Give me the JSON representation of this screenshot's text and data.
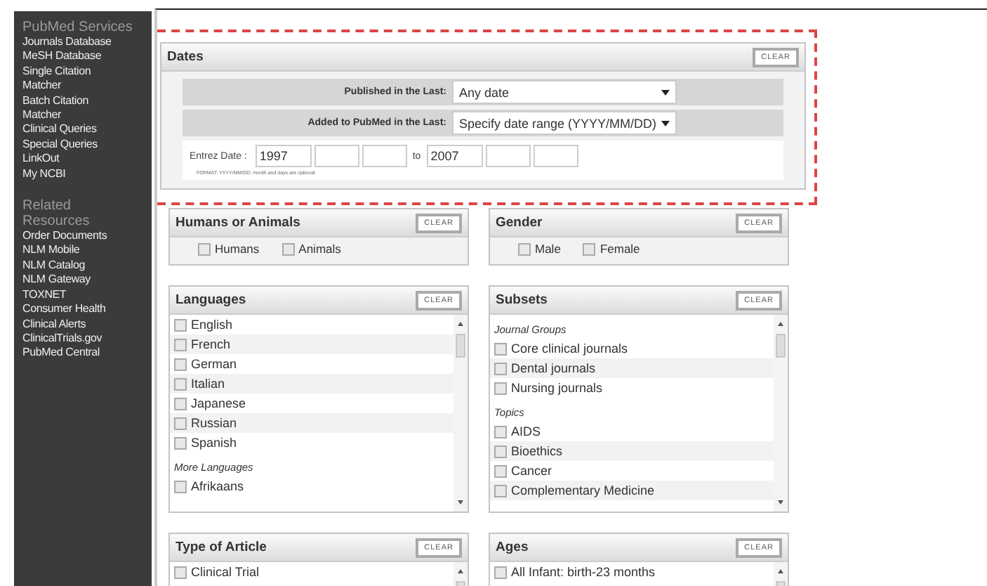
{
  "sidebar": {
    "sections": [
      {
        "heading": "PubMed Services",
        "items": [
          "Journals Database",
          "MeSH Database",
          "Single Citation Matcher",
          "Batch Citation Matcher",
          "Clinical Queries",
          "Special Queries",
          "LinkOut",
          "My NCBI"
        ]
      },
      {
        "heading": "Related Resources",
        "items": [
          "Order Documents",
          "NLM Mobile",
          "NLM Catalog",
          "NLM Gateway",
          "TOXNET",
          "Consumer Health",
          "Clinical Alerts",
          "ClinicalTrials.gov",
          "PubMed Central"
        ]
      }
    ]
  },
  "dates": {
    "title": "Dates",
    "clear": "CLEAR",
    "selects": [
      {
        "label": "Published in the Last:",
        "value": "Any date"
      },
      {
        "label": "Added to PubMed in the Last:",
        "value": "Specify date range (YYYY/MM/DD)"
      }
    ],
    "entrez": {
      "label": "Entrez Date :",
      "from_year": "1997",
      "to": "to",
      "to_year": "2007",
      "format": "FORMAT: YYYY/MM/DD; month and days are optional"
    }
  },
  "panel_rows": [
    [
      {
        "title": "Humans or Animals",
        "clear": "CLEAR",
        "kind": "inline",
        "items": [
          {
            "kind": "option",
            "label": "Humans",
            "checked": false
          },
          {
            "kind": "option",
            "label": "Animals",
            "checked": false
          }
        ]
      },
      {
        "title": "Gender",
        "clear": "CLEAR",
        "kind": "inline",
        "items": [
          {
            "kind": "option",
            "label": "Male",
            "checked": false
          },
          {
            "kind": "option",
            "label": "Female",
            "checked": false
          }
        ]
      }
    ],
    [
      {
        "title": "Languages",
        "clear": "CLEAR",
        "kind": "list",
        "items": [
          {
            "kind": "option",
            "label": "English",
            "checked": false
          },
          {
            "kind": "option",
            "label": "French",
            "checked": false
          },
          {
            "kind": "option",
            "label": "German",
            "checked": false
          },
          {
            "kind": "option",
            "label": "Italian",
            "checked": false
          },
          {
            "kind": "option",
            "label": "Japanese",
            "checked": false
          },
          {
            "kind": "option",
            "label": "Russian",
            "checked": false
          },
          {
            "kind": "option",
            "label": "Spanish",
            "checked": false
          },
          {
            "kind": "group",
            "label": "More Languages"
          },
          {
            "kind": "option",
            "label": "Afrikaans",
            "checked": false
          }
        ]
      },
      {
        "title": "Subsets",
        "clear": "CLEAR",
        "kind": "list",
        "items": [
          {
            "kind": "group",
            "label": "Journal Groups"
          },
          {
            "kind": "option",
            "label": "Core clinical journals",
            "checked": false
          },
          {
            "kind": "option",
            "label": "Dental journals",
            "checked": false
          },
          {
            "kind": "option",
            "label": "Nursing journals",
            "checked": false
          },
          {
            "kind": "group",
            "label": "Topics"
          },
          {
            "kind": "option",
            "label": "AIDS",
            "checked": false
          },
          {
            "kind": "option",
            "label": "Bioethics",
            "checked": false
          },
          {
            "kind": "option",
            "label": "Cancer",
            "checked": false
          },
          {
            "kind": "option",
            "label": "Complementary Medicine",
            "checked": false
          }
        ]
      }
    ],
    [
      {
        "title": "Type of Article",
        "clear": "CLEAR",
        "kind": "list",
        "items": [
          {
            "kind": "option",
            "label": "Clinical Trial",
            "checked": false
          }
        ]
      },
      {
        "title": "Ages",
        "clear": "CLEAR",
        "kind": "list",
        "items": [
          {
            "kind": "option",
            "label": "All Infant: birth-23 months",
            "checked": false
          }
        ]
      }
    ]
  ]
}
